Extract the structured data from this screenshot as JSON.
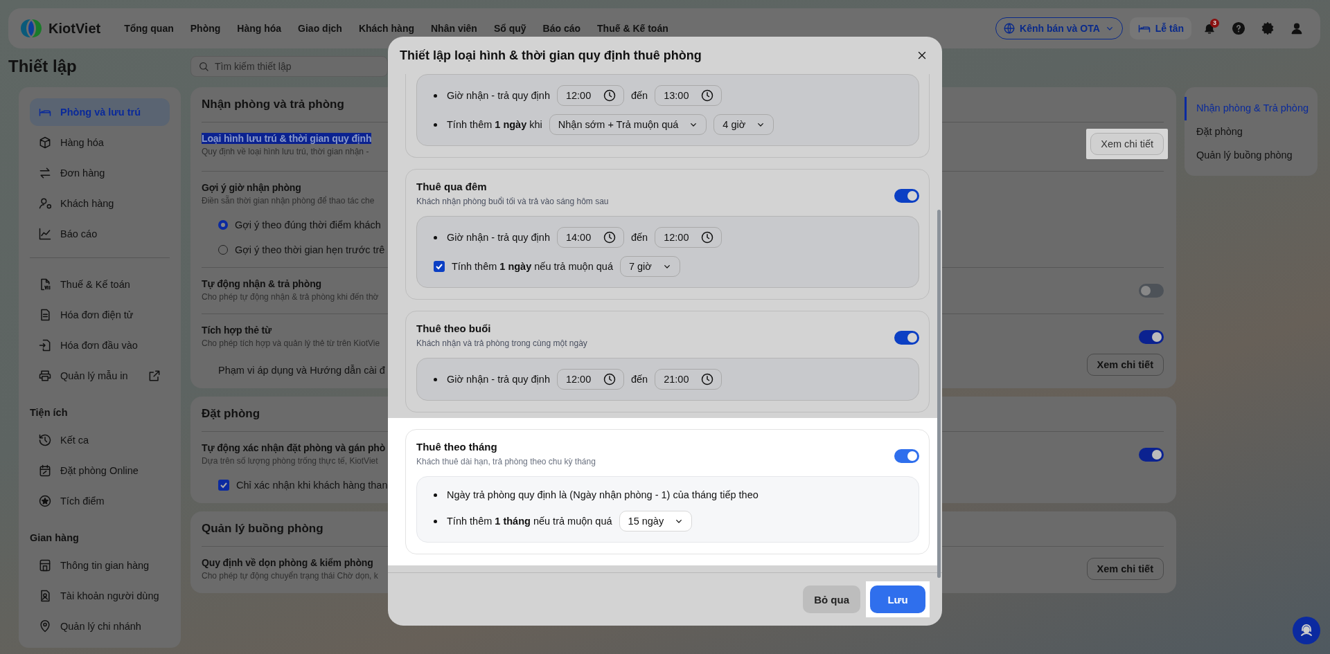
{
  "topbar": {
    "brand": "KiotViet",
    "nav": [
      {
        "label": "Tổng quan"
      },
      {
        "label": "Phòng"
      },
      {
        "label": "Hàng hóa"
      },
      {
        "label": "Giao dịch"
      },
      {
        "label": "Khách hàng"
      },
      {
        "label": "Nhân viên"
      },
      {
        "label": "Sổ quỹ"
      },
      {
        "label": "Báo cáo"
      },
      {
        "label": "Thuế & Kế toán"
      }
    ],
    "channel_button": "Kênh bán và OTA",
    "reception_button": "Lễ tân",
    "notification_count": "3"
  },
  "page_title": "Thiết lập",
  "search": {
    "placeholder": "Tìm kiếm thiết lập"
  },
  "sidebar": {
    "groups": [
      {
        "items": [
          {
            "label": "Phòng và lưu trú",
            "selected": true
          },
          {
            "label": "Hàng hóa",
            "selected": false
          },
          {
            "label": "Đơn hàng",
            "selected": false
          },
          {
            "label": "Khách hàng",
            "selected": false
          },
          {
            "label": "Báo cáo",
            "selected": false
          }
        ]
      },
      {
        "items": [
          {
            "label": "Thuế & Kế toán",
            "selected": false
          },
          {
            "label": "Hóa đơn điện tử",
            "selected": false
          },
          {
            "label": "Hóa đơn đầu vào",
            "selected": false
          },
          {
            "label": "Quản lý mẫu in",
            "selected": false,
            "external": true
          }
        ]
      },
      {
        "heading": "Tiện ích",
        "items": [
          {
            "label": "Kết ca",
            "selected": false
          },
          {
            "label": "Đặt phòng Online",
            "selected": false
          },
          {
            "label": "Tích điểm",
            "selected": false
          }
        ]
      },
      {
        "heading": "Gian hàng",
        "items": [
          {
            "label": "Thông tin gian hàng",
            "selected": false
          },
          {
            "label": "Tài khoản người dùng",
            "selected": false
          },
          {
            "label": "Quản lý chi nhánh",
            "selected": false
          }
        ]
      }
    ]
  },
  "sections": [
    {
      "title": "Nhận phòng và trả phòng",
      "settings": [
        {
          "kind": "button",
          "title": "Loại hình lưu trú & thời gian quy định",
          "title_selected": true,
          "description": "Quy định về loại hình lưu trú, thời gian nhận -",
          "button": {
            "label": "Xem chi tiết",
            "highlighted": true
          }
        },
        {
          "kind": "radios",
          "title": "Gợi ý giờ nhận phòng",
          "description": "Điền sẵn thời gian nhận phòng để thao tác che",
          "options": [
            {
              "label": "Gợi ý theo đúng thời điểm khách",
              "selected": true
            },
            {
              "label": "Gợi ý theo thời gian hẹn trước trê",
              "selected": false
            }
          ]
        },
        {
          "kind": "toggle",
          "title": "Tự động nhận & trả phòng",
          "description": "Cho phép tự động nhận & trả phòng khi đến thờ",
          "on": false
        },
        {
          "kind": "toggle",
          "title": "Tích hợp thẻ từ",
          "description": "Cho phép tích hợp và quản lý thẻ từ trên KiotVie",
          "on": true,
          "note": "Phạm vi áp dụng và Hướng dẫn cài đ",
          "button": {
            "label": "Xem chi tiết",
            "highlighted": false
          }
        }
      ]
    },
    {
      "title": "Đặt phòng",
      "settings": [
        {
          "kind": "toggle",
          "title": "Tự động xác nhận đặt phòng và gán phò",
          "description": "Dựa trên số lượng phòng trống thực tế, KiotViet",
          "on": true,
          "checkbox": {
            "label": "Chỉ xác nhận khi khách hàng than",
            "checked": true
          }
        }
      ]
    },
    {
      "title": "Quản lý buồng phòng",
      "settings": [
        {
          "kind": "button",
          "title": "Quy định về dọn phòng & kiểm phòng",
          "description": "Cho phép tự động chuyển trạng thái Chờ dọn, k",
          "button": {
            "label": "Xem chi tiết",
            "highlighted": false
          }
        }
      ]
    }
  ],
  "toc": {
    "items": [
      {
        "label": "Nhận phòng & Trả phòng",
        "selected": true
      },
      {
        "label": "Đặt phòng",
        "selected": false
      },
      {
        "label": "Quản lý buồng phòng",
        "selected": false
      }
    ]
  },
  "modal": {
    "title": "Thiết lập loại hình & thời gian quy định thuê phòng",
    "cards": [
      {
        "kind": "partial",
        "highlighted": false,
        "rows": [
          {
            "kind": "time_range",
            "label": "Giờ nhận - trả quy định",
            "from": "12:00",
            "sep": "đến",
            "to": "13:00"
          },
          {
            "kind": "select_rule",
            "label": "Tính thêm **1 ngày** khi",
            "selects": [
              "Nhận sớm + Trả muộn quá",
              "4 giờ"
            ]
          }
        ]
      },
      {
        "kind": "full",
        "title": "Thuê qua đêm",
        "description": "Khách nhận phòng buổi tối và trả vào sáng hôm sau",
        "enabled": true,
        "highlighted": false,
        "rows": [
          {
            "kind": "time_range",
            "label": "Giờ nhận - trả quy định",
            "from": "14:00",
            "sep": "đến",
            "to": "12:00"
          },
          {
            "kind": "check_rule",
            "checked": true,
            "label": "Tính thêm **1 ngày** nếu trả muộn quá",
            "select": "7 giờ"
          }
        ]
      },
      {
        "kind": "full",
        "title": "Thuê theo buổi",
        "description": "Khách nhận và trả phòng trong cùng một ngày",
        "enabled": true,
        "highlighted": false,
        "rows": [
          {
            "kind": "time_range",
            "label": "Giờ nhận - trả quy định",
            "from": "12:00",
            "sep": "đến",
            "to": "21:00"
          }
        ]
      },
      {
        "kind": "full",
        "title": "Thuê theo tháng",
        "description": "Khách thuê dài hạn, trả phòng theo chu kỳ tháng",
        "enabled": true,
        "highlighted": true,
        "rows": [
          {
            "kind": "text",
            "text": "Ngày trả phòng quy định là (Ngày nhận phòng - 1) của tháng tiếp theo"
          },
          {
            "kind": "select_rule",
            "label": "Tính thêm **1 tháng** nếu trả muộn quá",
            "selects": [
              "15 ngày"
            ]
          }
        ]
      }
    ],
    "cancel": "Bỏ qua",
    "save": {
      "label": "Lưu",
      "highlighted": true
    }
  }
}
